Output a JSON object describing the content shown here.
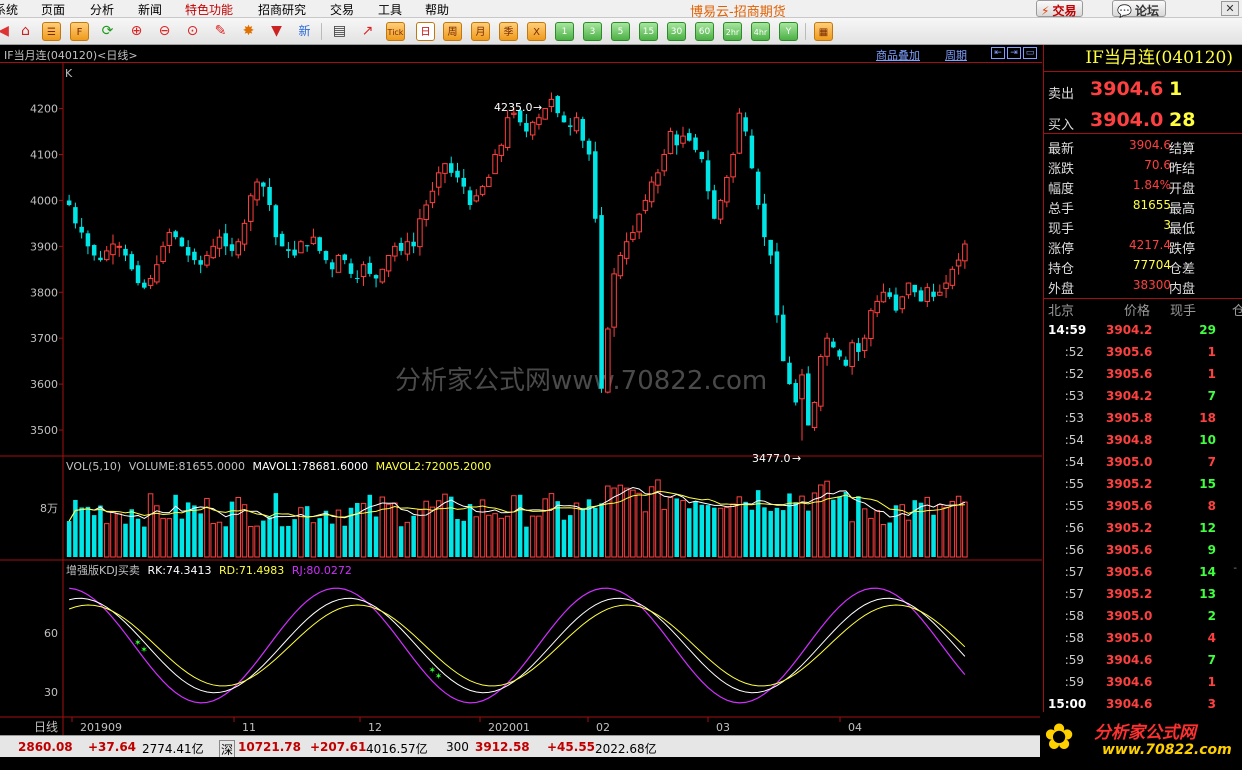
{
  "menu": {
    "items": [
      {
        "label": "系统",
        "hot": false
      },
      {
        "label": "页面",
        "hot": false
      },
      {
        "label": "分析",
        "hot": false
      },
      {
        "label": "新闻",
        "hot": false
      },
      {
        "label": "特色功能",
        "hot": true
      },
      {
        "label": "招商研究",
        "hot": false
      },
      {
        "label": "交易",
        "hot": false
      },
      {
        "label": "工具",
        "hot": false
      },
      {
        "label": "帮助",
        "hot": false
      }
    ],
    "app_title": "博易云-招商期货",
    "trade_btn": "交易",
    "forum_btn": "论坛"
  },
  "toolbar": {
    "icons": [
      "home-icon",
      "refresh-icon",
      "zoom-in-icon",
      "zoom-out-icon",
      "draw-icon",
      "indicator-icon",
      "filter-icon",
      "new-icon",
      "list-icon",
      "chart-icon",
      "tick-icon"
    ],
    "tick_label": "Tick",
    "new_label": "新",
    "periods": [
      "日",
      "周",
      "月",
      "季",
      "X",
      "1",
      "3",
      "5",
      "15",
      "30",
      "60",
      "2hr",
      "4hr",
      "Y"
    ],
    "active_period": "日"
  },
  "chart": {
    "title": "IF当月连(040120)<日线>",
    "overlay_link": "商品叠加",
    "cycle_link": "周期",
    "k_label": "K",
    "y_ticks": [
      4200,
      4100,
      4000,
      3900,
      3800,
      3700,
      3600,
      3500
    ],
    "high_label": "4235.0",
    "low_label": "3477.0",
    "watermark": "分析家公式网www.70822.com",
    "vol_header": {
      "name": "VOL(5,10)",
      "volume": "VOLUME:81655.0000",
      "mavol1": "MAVOL1:78681.6000",
      "mavol2": "MAVOL2:72005.2000"
    },
    "vol_tick": "8万",
    "kdj_header": {
      "name": "增强版KDJ买卖",
      "rk": "RK:74.3413",
      "rd": "RD:71.4983",
      "rj": "RJ:80.0272"
    },
    "kdj_ticks": [
      "60",
      "30"
    ],
    "x_prefix": "日线",
    "x_labels": [
      "201909",
      "11",
      "12",
      "202001",
      "02",
      "03",
      "04"
    ],
    "colors": {
      "up": "#ff4040",
      "down": "#00e5e5",
      "mavol1": "#ffffff",
      "mavol2": "#ffff40",
      "rj": "#d030ff",
      "grid": "#a01010"
    }
  },
  "chart_data": {
    "type": "candlestick",
    "title": "IF当月连(040120)<日线>",
    "ylim": [
      3450,
      4260
    ],
    "high": 4235.0,
    "low": 3477.0,
    "closes": [
      3990,
      3950,
      3930,
      3900,
      3880,
      3870,
      3890,
      3905,
      3900,
      3880,
      3850,
      3820,
      3810,
      3830,
      3860,
      3900,
      3930,
      3920,
      3900,
      3880,
      3870,
      3860,
      3880,
      3900,
      3920,
      3900,
      3890,
      3910,
      3950,
      4010,
      4040,
      4030,
      3990,
      3920,
      3900,
      3890,
      3880,
      3910,
      3900,
      3920,
      3890,
      3870,
      3850,
      3880,
      3870,
      3840,
      3830,
      3860,
      3840,
      3830,
      3850,
      3880,
      3900,
      3890,
      3910,
      3900,
      3960,
      3990,
      4020,
      4060,
      4080,
      4060,
      4050,
      4030,
      3990,
      4010,
      4030,
      4050,
      4100,
      4120,
      4180,
      4190,
      4170,
      4150,
      4170,
      4180,
      4200,
      4220,
      4190,
      4170,
      4160,
      4180,
      4130,
      4100,
      3960,
      3590,
      3720,
      3840,
      3880,
      3910,
      3930,
      3970,
      4000,
      4040,
      4060,
      4100,
      4150,
      4120,
      4140,
      4130,
      4110,
      4090,
      4020,
      3960,
      4000,
      4050,
      4100,
      4190,
      4150,
      4070,
      3990,
      3920,
      3880,
      3750,
      3650,
      3600,
      3560,
      3620,
      3510,
      3560,
      3660,
      3700,
      3680,
      3660,
      3640,
      3690,
      3670,
      3700,
      3760,
      3780,
      3800,
      3790,
      3760,
      3790,
      3820,
      3800,
      3780,
      3810,
      3790,
      3800,
      3820,
      3850,
      3870,
      3905
    ],
    "volume": {
      "last": 81655,
      "mavol1": 78681.6,
      "mavol2": 72005.2
    },
    "kdj": {
      "rk": 74.3413,
      "rd": 71.4983,
      "rj": 80.0272
    },
    "x_labels": [
      "201909",
      "11",
      "12",
      "202001",
      "02",
      "03",
      "04"
    ]
  },
  "quote": {
    "title": "IF当月连(040120)",
    "ask": {
      "label": "卖出",
      "price": "3904.6",
      "vol": "1"
    },
    "bid": {
      "label": "买入",
      "price": "3904.0",
      "vol": "28"
    },
    "rows": [
      {
        "k1": "最新",
        "v1": "3904.6",
        "c": "#ff4040",
        "k2": "结算"
      },
      {
        "k1": "涨跌",
        "v1": "70.6",
        "c": "#ff4040",
        "k2": "昨结"
      },
      {
        "k1": "幅度",
        "v1": "1.84%",
        "c": "#ff4040",
        "k2": "开盘"
      },
      {
        "k1": "总手",
        "v1": "81655",
        "c": "#ffff40",
        "k2": "最高"
      },
      {
        "k1": "现手",
        "v1": "3",
        "c": "#ffff40",
        "k2": "最低"
      },
      {
        "k1": "涨停",
        "v1": "4217.4",
        "c": "#ff4040",
        "k2": "跌停"
      },
      {
        "k1": "持仓",
        "v1": "77704",
        "c": "#ffff40",
        "k2": "仓差"
      },
      {
        "k1": "外盘",
        "v1": "38300",
        "c": "#ff4040",
        "k2": "内盘"
      }
    ],
    "tick_head": {
      "place": "北京",
      "price": "价格",
      "now": "现手",
      "pos": "仓"
    },
    "ticks": [
      {
        "t": "14:59",
        "p": "3904.2",
        "v": "29",
        "dir": "dn",
        "full": true
      },
      {
        "t": ":52",
        "p": "3905.6",
        "v": "1",
        "dir": "up"
      },
      {
        "t": ":52",
        "p": "3905.6",
        "v": "1",
        "dir": "up"
      },
      {
        "t": ":53",
        "p": "3904.2",
        "v": "7",
        "dir": "dn"
      },
      {
        "t": ":53",
        "p": "3905.8",
        "v": "18",
        "dir": "up"
      },
      {
        "t": ":54",
        "p": "3904.8",
        "v": "10",
        "dir": "dn"
      },
      {
        "t": ":54",
        "p": "3905.0",
        "v": "7",
        "dir": "up"
      },
      {
        "t": ":55",
        "p": "3905.2",
        "v": "15",
        "dir": "dn"
      },
      {
        "t": ":55",
        "p": "3905.6",
        "v": "8",
        "dir": "up"
      },
      {
        "t": ":56",
        "p": "3905.2",
        "v": "12",
        "dir": "dn"
      },
      {
        "t": ":56",
        "p": "3905.6",
        "v": "9",
        "dir": "dn"
      },
      {
        "t": ":57",
        "p": "3905.6",
        "v": "14",
        "dir": "dn"
      },
      {
        "t": ":57",
        "p": "3905.2",
        "v": "13",
        "dir": "dn"
      },
      {
        "t": ":58",
        "p": "3905.0",
        "v": "2",
        "dir": "dn"
      },
      {
        "t": ":58",
        "p": "3905.0",
        "v": "4",
        "dir": "up"
      },
      {
        "t": ":59",
        "p": "3904.6",
        "v": "7",
        "dir": "dn"
      },
      {
        "t": ":59",
        "p": "3904.6",
        "v": "1",
        "dir": "up"
      },
      {
        "t": "15:00",
        "p": "3904.6",
        "v": "3",
        "dir": "up",
        "full": true
      }
    ]
  },
  "status": [
    {
      "name": "",
      "price": "2860.08",
      "chg": "+37.64",
      "amt": "2774.41亿"
    },
    {
      "name": "深",
      "price": "10721.78",
      "chg": "+207.61",
      "amt": "4016.57亿"
    },
    {
      "name": "300",
      "price": "3912.58",
      "chg": "+45.55",
      "amt": "2022.68亿"
    }
  ],
  "logo": {
    "brand": "分析家公式网",
    "url": "www.70822.com"
  }
}
